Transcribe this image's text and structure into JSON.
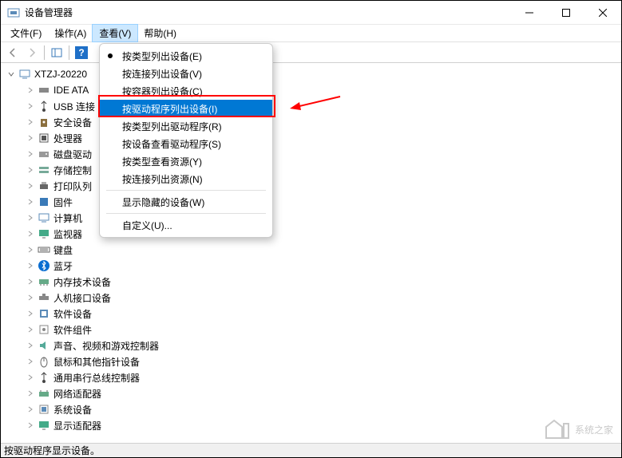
{
  "window": {
    "title": "设备管理器"
  },
  "menubar": {
    "file": "文件(F)",
    "action": "操作(A)",
    "view": "查看(V)",
    "help": "帮助(H)"
  },
  "dropdown": {
    "items": [
      {
        "label": "按类型列出设备(E)",
        "dot": true
      },
      {
        "label": "按连接列出设备(V)"
      },
      {
        "label": "按容器列出设备(C)"
      },
      {
        "label": "按驱动程序列出设备(I)",
        "highlighted": true
      },
      {
        "label": "按类型列出驱动程序(R)"
      },
      {
        "label": "按设备查看驱动程序(S)"
      },
      {
        "label": "按类型查看资源(Y)"
      },
      {
        "label": "按连接列出资源(N)"
      },
      {
        "sep": true
      },
      {
        "label": "显示隐藏的设备(W)"
      },
      {
        "sep": true
      },
      {
        "label": "自定义(U)..."
      }
    ]
  },
  "tree": {
    "root": "XTZJ-20220",
    "children": [
      {
        "icon": "ide",
        "label": "IDE ATA"
      },
      {
        "icon": "usb",
        "label": "USB 连接"
      },
      {
        "icon": "security",
        "label": "安全设备"
      },
      {
        "icon": "cpu",
        "label": "处理器"
      },
      {
        "icon": "disk",
        "label": "磁盘驱动"
      },
      {
        "icon": "storage",
        "label": "存储控制"
      },
      {
        "icon": "printer",
        "label": "打印队列"
      },
      {
        "icon": "firmware",
        "label": "固件"
      },
      {
        "icon": "computer",
        "label": "计算机"
      },
      {
        "icon": "monitor",
        "label": "监视器"
      },
      {
        "icon": "keyboard",
        "label": "键盘"
      },
      {
        "icon": "bluetooth",
        "label": "蓝牙"
      },
      {
        "icon": "memory",
        "label": "内存技术设备"
      },
      {
        "icon": "hid",
        "label": "人机接口设备"
      },
      {
        "icon": "software",
        "label": "软件设备"
      },
      {
        "icon": "component",
        "label": "软件组件"
      },
      {
        "icon": "audio",
        "label": "声音、视频和游戏控制器"
      },
      {
        "icon": "mouse",
        "label": "鼠标和其他指针设备"
      },
      {
        "icon": "serial",
        "label": "通用串行总线控制器"
      },
      {
        "icon": "network",
        "label": "网络适配器"
      },
      {
        "icon": "system",
        "label": "系统设备"
      },
      {
        "icon": "display",
        "label": "显示适配器"
      }
    ]
  },
  "statusbar": {
    "text": "按驱动程序显示设备。"
  },
  "watermark": {
    "text": "系统之家"
  }
}
